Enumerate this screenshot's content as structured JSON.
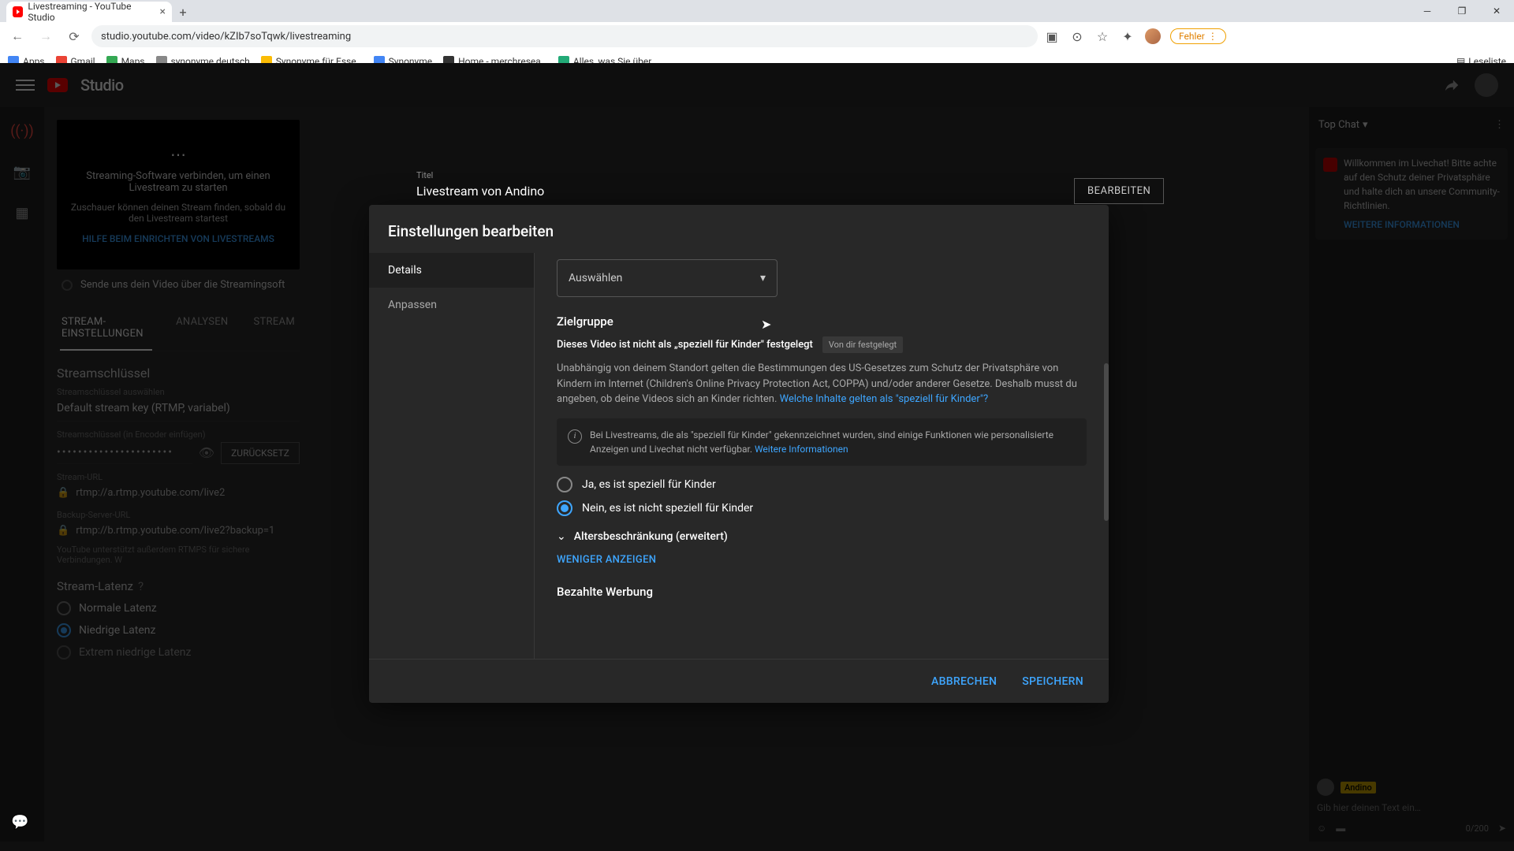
{
  "browser": {
    "tab_title": "Livestreaming - YouTube Studio",
    "url": "studio.youtube.com/video/kZIb7soTqwk/livestreaming",
    "bookmarks": [
      "Apps",
      "Gmail",
      "Maps",
      "synonyme deutsch",
      "Synonyme für Esse…",
      "Synonyme",
      "Home - merchresea…",
      "Alles, was Sie über…"
    ],
    "readlist": "Leseliste",
    "error_chip": "Fehler"
  },
  "header": {
    "brand": "Studio"
  },
  "chat": {
    "tab": "Top Chat",
    "welcome": "Willkommen im Livechat! Bitte achte auf den Schutz deiner Privatsphäre und halte dich an unsere Community-Richtlinien.",
    "welcome_link": "WEITERE INFORMATIONEN",
    "username": "Andino",
    "placeholder": "Gib hier deinen Text ein…",
    "char_count": "0/200"
  },
  "background": {
    "preview_hint1": "Streaming-Software verbinden, um einen Livestream zu starten",
    "preview_hint2": "Zuschauer können deinen Stream finden, sobald du den Livestream startest",
    "help_link": "HILFE BEIM EINRICHTEN VON LIVESTREAMS",
    "send_row": "Sende uns dein Video über die Streamingsoft",
    "tabs": [
      "STREAM-EINSTELLUNGEN",
      "ANALYSEN",
      "STREAM"
    ],
    "key_head": "Streamschlüssel",
    "key_label": "Streamschlüssel auswählen",
    "key_value": "Default stream key (RTMP, variabel)",
    "enc_label": "Streamschlüssel (in Encoder einfügen)",
    "key_mask": "••••••••••••••••••••••",
    "reset": "ZURÜCKSETZ",
    "url_label": "Stream-URL",
    "url_value": "rtmp://a.rtmp.youtube.com/live2",
    "backup_label": "Backup-Server-URL",
    "backup_value": "rtmp://b.rtmp.youtube.com/live2?backup=1",
    "foot_note": "YouTube unterstützt außerdem RTMPS für sichere Verbindungen. W",
    "latency": "Stream-Latenz",
    "lat_opts": [
      "Normale Latenz",
      "Niedrige Latenz",
      "Extrem niedrige Latenz"
    ],
    "titel_label": "Titel",
    "titel_value": "Livestream von Andino",
    "edit": "BEARBEITEN"
  },
  "modal": {
    "title": "Einstellungen bearbeiten",
    "side": {
      "details": "Details",
      "customize": "Anpassen"
    },
    "dropdown": "Auswählen",
    "audience_head": "Zielgruppe",
    "status_text": "Dieses Video ist nicht als „speziell für Kinder\" festgelegt",
    "status_chip": "Von dir festgelegt",
    "paragraph": "Unabhängig von deinem Standort gelten die Bestimmungen des US-Gesetzes zum Schutz der Privatsphäre von Kindern im Internet (Children's Online Privacy Protection Act, COPPA) und/oder anderer Gesetze. Deshalb musst du angeben, ob deine Videos sich an Kinder richten.",
    "para_link": "Welche Inhalte gelten als \"speziell für Kinder\"?",
    "info": "Bei Livestreams, die als \"speziell für Kinder\" gekennzeichnet wurden, sind einige Funktionen wie personalisierte Anzeigen und Livechat nicht verfügbar.",
    "info_link": "Weitere Informationen",
    "radio_yes": "Ja, es ist speziell für Kinder",
    "radio_no": "Nein, es ist nicht speziell für Kinder",
    "age_expand": "Altersbeschränkung (erweitert)",
    "show_less": "WENIGER ANZEIGEN",
    "paid_head": "Bezahlte Werbung",
    "cancel": "ABBRECHEN",
    "save": "SPEICHERN"
  }
}
